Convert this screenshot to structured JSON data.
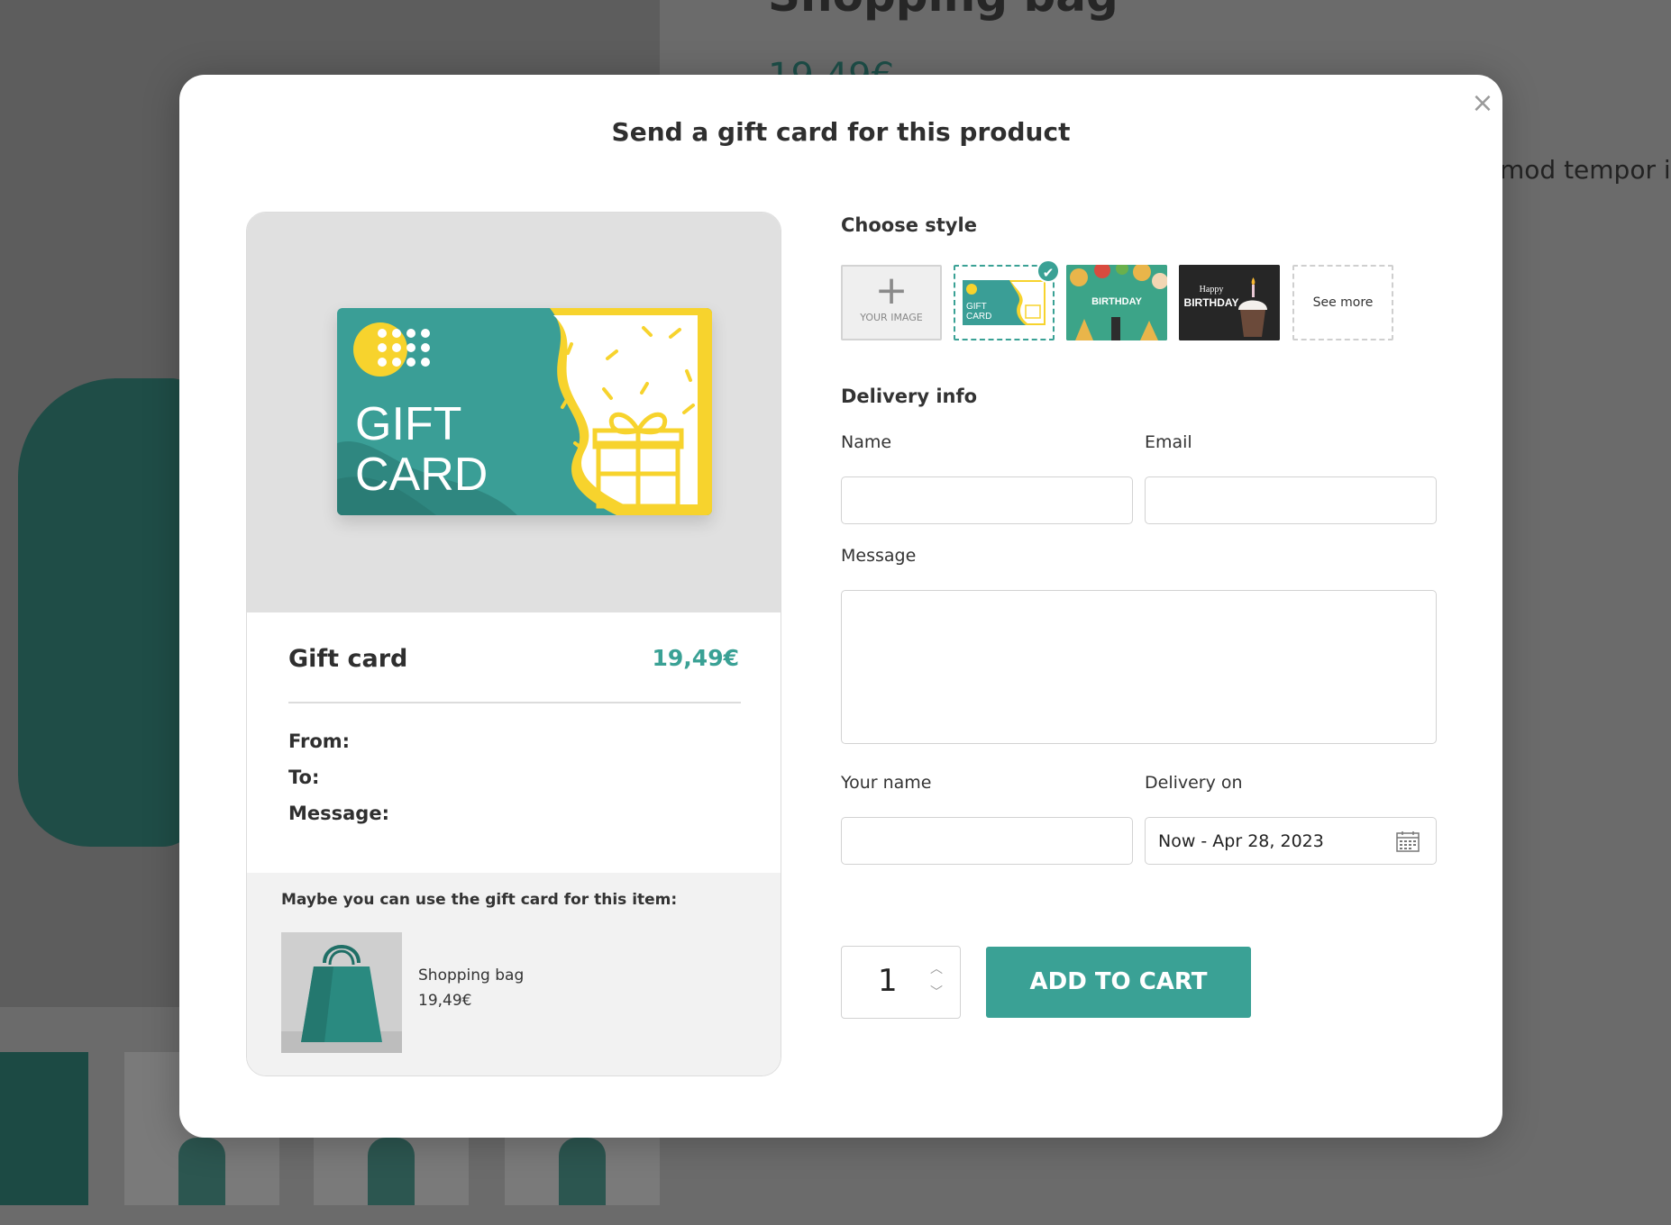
{
  "background": {
    "title": "Shopping bag",
    "price": "19,49€",
    "description": "mod tempor inc"
  },
  "modal": {
    "title": "Send a gift card for this product",
    "close_label": "×"
  },
  "preview": {
    "card_text_line1": "GIFT",
    "card_text_line2": "CARD",
    "title": "Gift card",
    "price": "19,49€",
    "from_label": "From:",
    "to_label": "To:",
    "message_label": "Message:",
    "suggest_label": "Maybe you can use the gift card for this item:",
    "suggest_item_name": "Shopping bag",
    "suggest_item_price": "19,49€"
  },
  "style": {
    "heading": "Choose style",
    "upload_caption": "YOUR IMAGE",
    "selected_caption_1": "GIFT",
    "selected_caption_2": "CARD",
    "birthday1_text": "BIRTHDAY",
    "birthday2_text_top": "Happy",
    "birthday2_text_bottom": "BIRTHDAY",
    "see_more": "See more",
    "check_icon": "✔"
  },
  "delivery": {
    "heading": "Delivery info",
    "name_label": "Name",
    "email_label": "Email",
    "message_label": "Message",
    "your_name_label": "Your name",
    "delivery_on_label": "Delivery on",
    "delivery_on_value": "Now - Apr 28, 2023"
  },
  "cart": {
    "quantity": "1",
    "up_icon": "︿",
    "down_icon": "﹀",
    "add_label": "ADD TO CART"
  },
  "colors": {
    "accent": "#3aa195",
    "card_teal": "#3a9e96",
    "card_yellow": "#f7d32d"
  }
}
